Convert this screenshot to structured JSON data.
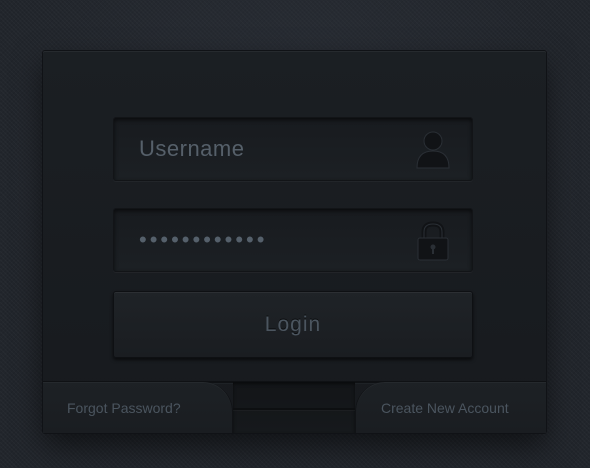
{
  "login_form": {
    "username": {
      "placeholder": "Username",
      "value": "",
      "icon": "user-icon"
    },
    "password": {
      "value": "••••••••••••",
      "icon": "lock-icon"
    },
    "login_button_label": "Login"
  },
  "footer": {
    "forgot_password_label": "Forgot Password?",
    "create_account_label": "Create New Account"
  },
  "colors": {
    "panel": "#1a1d21",
    "field": "#1c2024",
    "text": "#4b555f",
    "background": "#22262c"
  }
}
